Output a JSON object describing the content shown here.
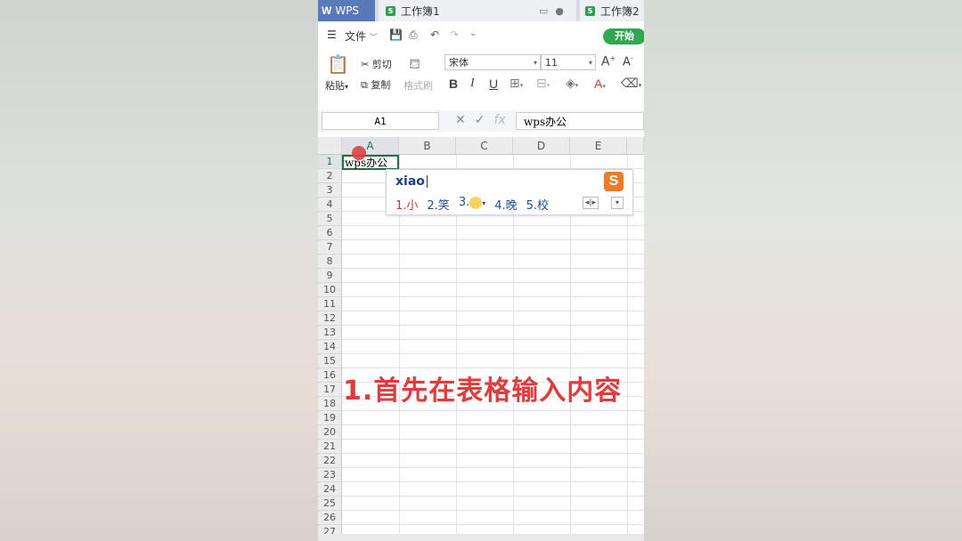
{
  "titlebar": {
    "app_name": "WPS",
    "tabs": [
      {
        "label": "工作簿1"
      },
      {
        "label": "工作簿2"
      }
    ]
  },
  "quickbar": {
    "file_menu": "文件",
    "start_tab": "开始"
  },
  "ribbon": {
    "paste": "粘贴",
    "cut": "剪切",
    "copy": "复制",
    "format_painter": "格式刷",
    "font_name": "宋体",
    "font_size": "11",
    "bold": "B",
    "italic": "I",
    "underline": "U"
  },
  "formula_bar": {
    "cell_ref": "A1",
    "fx_label": "fx",
    "content": "wps办公"
  },
  "grid": {
    "columns": [
      "A",
      "B",
      "C",
      "D",
      "E"
    ],
    "rows": [
      "1",
      "2",
      "3",
      "4",
      "5",
      "6",
      "7",
      "8",
      "9",
      "10",
      "11",
      "12",
      "13",
      "14",
      "15",
      "16",
      "17",
      "18",
      "19",
      "20",
      "21",
      "22",
      "23",
      "24",
      "25",
      "26",
      "27"
    ],
    "cell_a1": "wps办公"
  },
  "ime": {
    "pinyin": "xiao",
    "logo": "S",
    "candidates": [
      "1.小",
      "2.笑",
      "3.",
      "4.晚",
      "5.校"
    ]
  },
  "caption": "1.首先在表格输入内容",
  "colors": {
    "wps_blue": "#5a79b9",
    "start_green": "#2fa84f",
    "caption_red": "#e5393a",
    "selection_green": "#217346"
  }
}
